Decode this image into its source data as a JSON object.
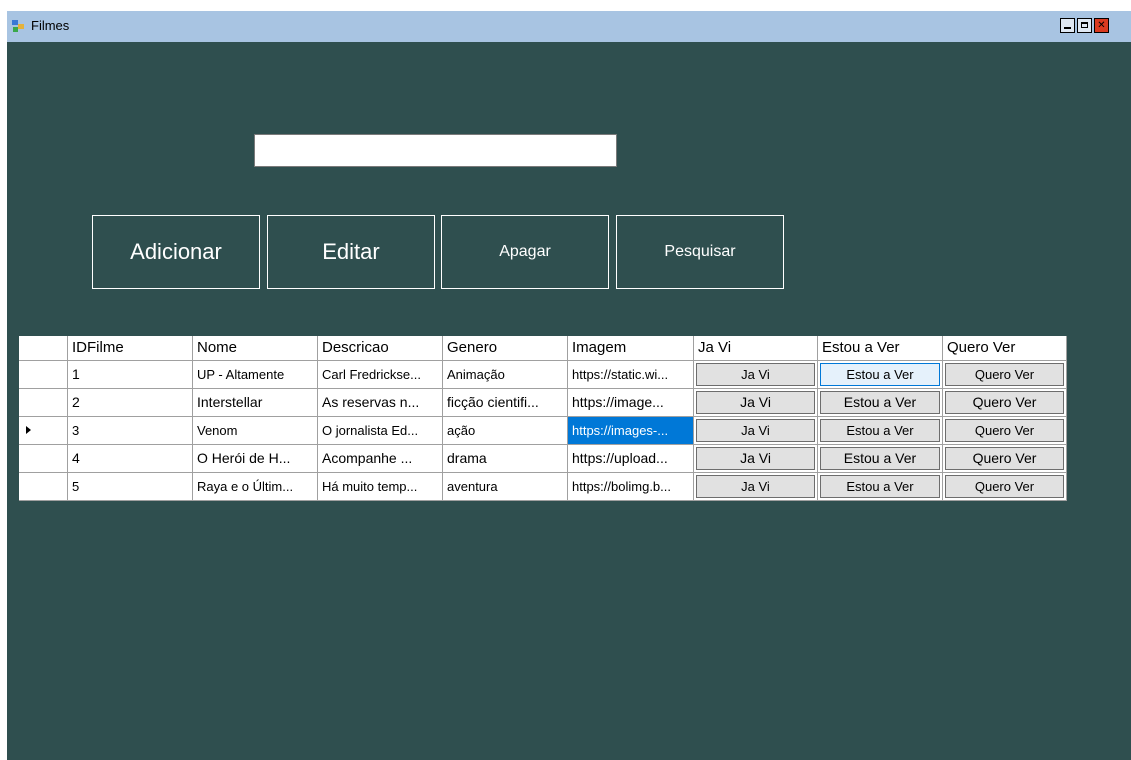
{
  "window": {
    "title": "Filmes",
    "icon": "form-icon",
    "controls": [
      "minimize-icon",
      "maximize-icon",
      "close-icon"
    ],
    "close_glyph": "✕"
  },
  "form": {
    "search_value": "",
    "buttons": {
      "add": "Adicionar",
      "edit": "Editar",
      "delete": "Apagar",
      "search": "Pesquisar"
    }
  },
  "grid": {
    "columns": [
      "IDFilme",
      "Nome",
      "Descricao",
      "Genero",
      "Imagem",
      "Ja Vi",
      "Estou a Ver",
      "Quero Ver"
    ],
    "current_row_index": 2,
    "selected_cell": {
      "row": 2,
      "column": "Imagem"
    },
    "rows": [
      {
        "id": "1",
        "nome": "UP - Altamente",
        "descricao": "Carl Fredrickse...",
        "genero": "Animação",
        "imagem": "https://static.wi...",
        "ja_vi": "Ja Vi",
        "estou_a_ver": "Estou a Ver",
        "quero_ver": "Quero Ver"
      },
      {
        "id": "2",
        "nome": "Interstellar",
        "descricao": "As reservas n...",
        "genero": "ficção cientifi...",
        "imagem": "https://image...",
        "ja_vi": "Ja Vi",
        "estou_a_ver": "Estou a Ver",
        "quero_ver": "Quero Ver"
      },
      {
        "id": "3",
        "nome": "Venom",
        "descricao": "O jornalista Ed...",
        "genero": "ação",
        "imagem": "https://images-...",
        "ja_vi": "Ja Vi",
        "estou_a_ver": "Estou a Ver",
        "quero_ver": "Quero Ver"
      },
      {
        "id": "4",
        "nome": "O Herói de H...",
        "descricao": "Acompanhe ...",
        "genero": "drama",
        "imagem": "https://upload...",
        "ja_vi": "Ja Vi",
        "estou_a_ver": "Estou a Ver",
        "quero_ver": "Quero Ver"
      },
      {
        "id": "5",
        "nome": "Raya e o Últim...",
        "descricao": "Há muito temp...",
        "genero": "aventura",
        "imagem": "https://bolimg.b...",
        "ja_vi": "Ja Vi",
        "estou_a_ver": "Estou a Ver",
        "quero_ver": "Quero Ver"
      }
    ]
  },
  "colors": {
    "form_background": "#2f4f4f",
    "titlebar": "#a8c4e2",
    "selection": "#0078d7",
    "close_button": "#d93a20"
  }
}
